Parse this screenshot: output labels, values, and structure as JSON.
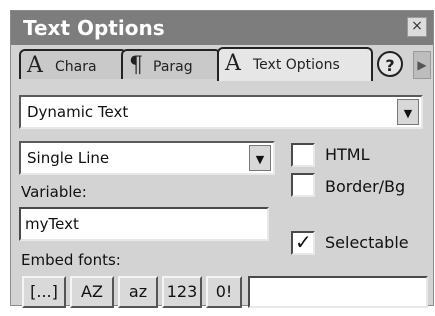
{
  "panel": {
    "title": "Text Options",
    "close_glyph": "×"
  },
  "tabs": [
    {
      "icon": "A",
      "icon_name": "character-icon",
      "label": "Chara",
      "active": false
    },
    {
      "icon": "¶",
      "icon_name": "paragraph-icon",
      "label": "Parag",
      "active": false
    },
    {
      "icon": "A",
      "icon_name": "text-options-icon",
      "label": "Text Options",
      "active": true
    }
  ],
  "help_glyph": "?",
  "tab_scroll_glyph": "▶",
  "text_type": {
    "value": "Dynamic Text"
  },
  "line_type": {
    "value": "Single Line"
  },
  "html_checkbox": {
    "label": "HTML",
    "checked": false
  },
  "border_checkbox": {
    "label": "Border/Bg",
    "checked": false
  },
  "variable": {
    "label": "Variable:",
    "value": "myText"
  },
  "selectable_checkbox": {
    "label": "Selectable",
    "checked": true,
    "mark": "✓"
  },
  "embed": {
    "label": "Embed fonts:",
    "buttons": [
      "[...]",
      "AZ",
      "az",
      "123",
      "0!"
    ]
  },
  "embed_chars_input": {
    "value": ""
  }
}
